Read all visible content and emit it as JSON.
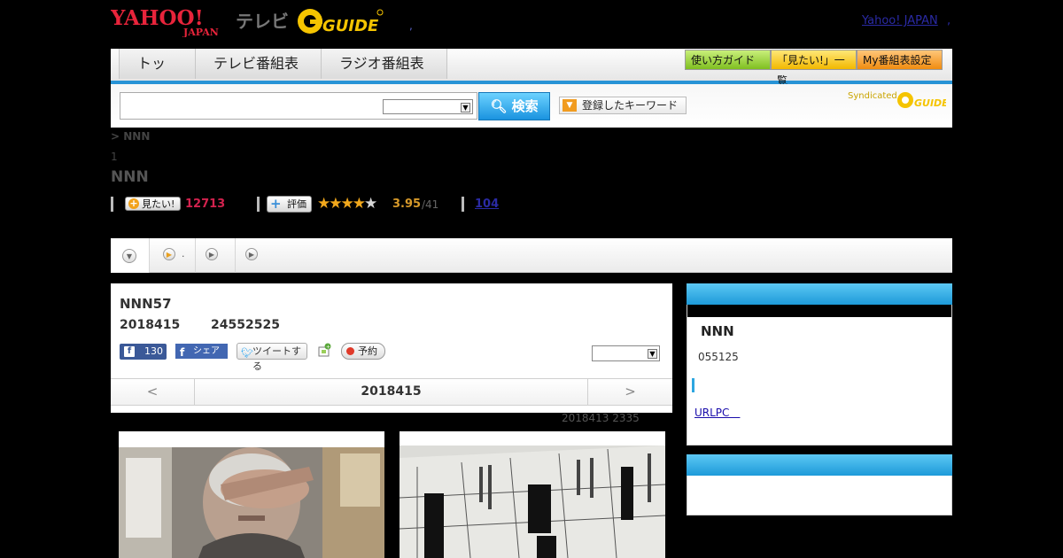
{
  "header": {
    "yahoo_logo": "YAHOO! JAPAN",
    "tv_label": "テレビ",
    "gguide_logo": "G GUIDE",
    "separator": ",",
    "yahoo_japan_link": "Yahoo! JAPAN",
    "link_comma": ","
  },
  "nav": {
    "tabs": [
      {
        "label": "トップ"
      },
      {
        "label": "テレビ番組表"
      },
      {
        "label": "ラジオ番組表"
      }
    ],
    "guide_button": "使い方ガイド",
    "mitai_list_button": "「見たい!」一覧",
    "my_bangumi_button": "My番組表設定"
  },
  "search": {
    "input_value": "",
    "select_value": "",
    "button_label": "検索",
    "keyword_button": "登録したキーワード",
    "syndicated_label": "Syndicated"
  },
  "breadcrumb": "> NNN",
  "page_number": "1",
  "page_title": "NNN",
  "stats": {
    "mitai_label": "見たい!",
    "mitai_count": "12713",
    "hyoka_label": "評価",
    "rating": 3.95,
    "rating_display": "3.95",
    "rating_count": "/41",
    "link_104": "104"
  },
  "subtabs": [
    {
      "label": ""
    },
    {
      "label": "."
    },
    {
      "label": ""
    },
    {
      "label": ""
    }
  ],
  "program": {
    "title": "NNN57",
    "date": "2018415",
    "time": "24552525",
    "fb_like_count": "130",
    "fb_share_label": "シェア",
    "tweet_label": "ツイートする",
    "yoyaku_label": "予約",
    "select_value": ""
  },
  "date_nav": {
    "prev": "<",
    "label": "2018415",
    "next": ">"
  },
  "updated": "2018413  2335",
  "sidebar": {
    "title": "NNN",
    "time": "055125",
    "link": "URLPC　"
  },
  "colors": {
    "accent_blue": "#1d9ad9",
    "mitai_red": "#d3224e",
    "star": "#f2a81c"
  }
}
